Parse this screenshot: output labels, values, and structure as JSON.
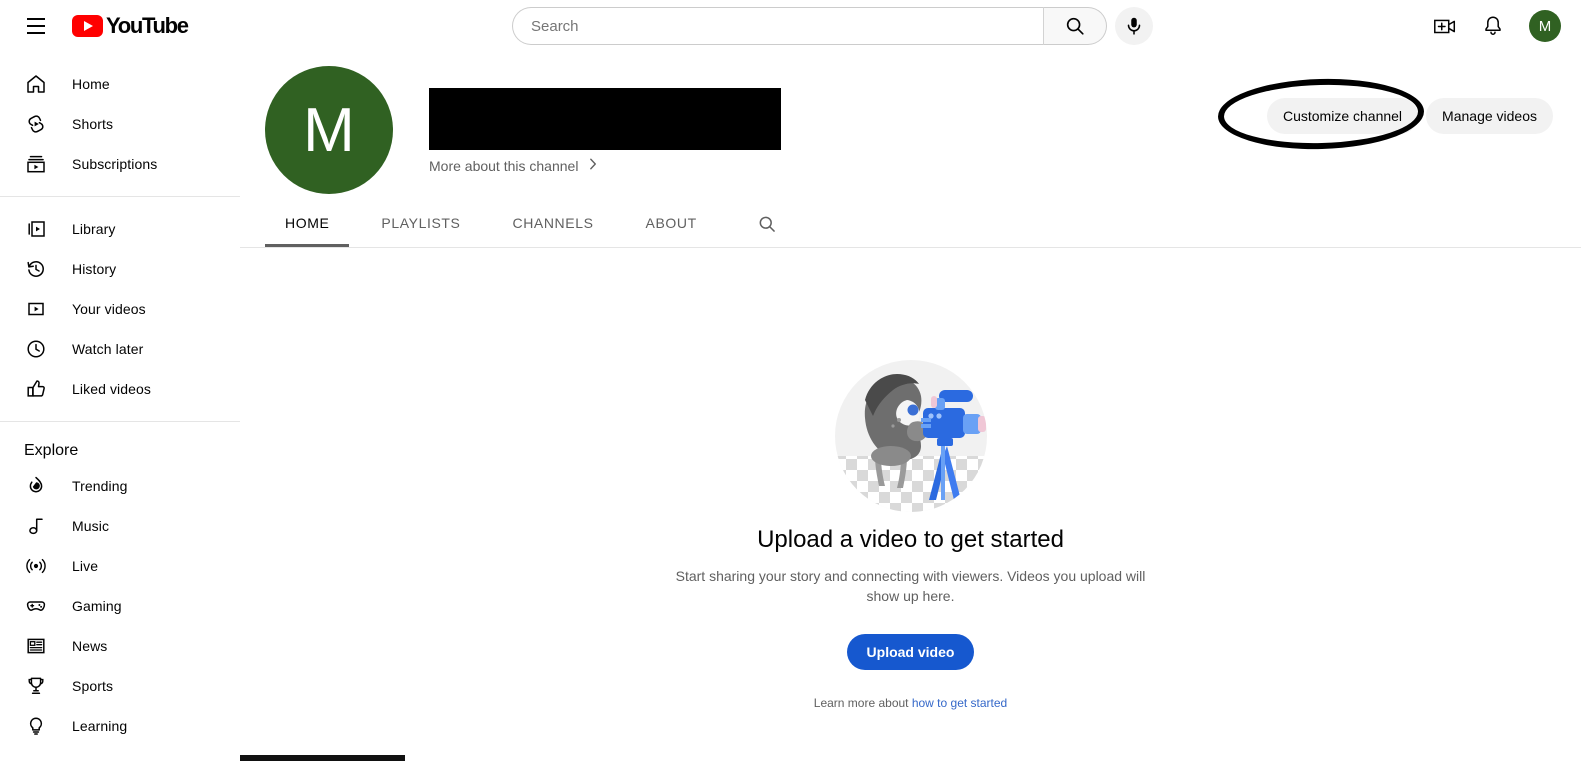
{
  "brand": {
    "name": "YouTube",
    "logo_color": "#FF0000",
    "accent_blue": "#1658cf",
    "avatar_color": "#306122"
  },
  "header": {
    "menu_icon": "hamburger-menu-icon",
    "logo_label": "YouTube",
    "search": {
      "placeholder": "Search",
      "value": "",
      "search_icon": "magnifier-icon",
      "mic_icon": "microphone-icon"
    },
    "create_icon": "create-video-icon",
    "notifications_icon": "bell-icon",
    "avatar_initial": "M"
  },
  "sidebar": {
    "primary": [
      {
        "label": "Home",
        "icon": "home-icon",
        "active": false
      },
      {
        "label": "Shorts",
        "icon": "shorts-icon",
        "active": false
      },
      {
        "label": "Subscriptions",
        "icon": "subscriptions-icon",
        "active": false
      }
    ],
    "library": [
      {
        "label": "Library",
        "icon": "library-icon"
      },
      {
        "label": "History",
        "icon": "history-icon"
      },
      {
        "label": "Your videos",
        "icon": "your-videos-icon"
      },
      {
        "label": "Watch later",
        "icon": "clock-icon"
      },
      {
        "label": "Liked videos",
        "icon": "thumbs-up-icon"
      }
    ],
    "explore_heading": "Explore",
    "explore": [
      {
        "label": "Trending",
        "icon": "trending-flame-icon"
      },
      {
        "label": "Music",
        "icon": "music-note-icon"
      },
      {
        "label": "Live",
        "icon": "live-broadcast-icon"
      },
      {
        "label": "Gaming",
        "icon": "gamepad-icon"
      },
      {
        "label": "News",
        "icon": "newspaper-icon"
      },
      {
        "label": "Sports",
        "icon": "trophy-icon"
      },
      {
        "label": "Learning",
        "icon": "lightbulb-icon"
      }
    ]
  },
  "channel": {
    "avatar_initial": "M",
    "name_redacted": true,
    "more_about_label": "More about this channel",
    "more_about_chevron": "chevron-right-icon",
    "customize_button": "Customize channel",
    "manage_button": "Manage videos",
    "annotation": {
      "type": "hand-drawn-ellipse",
      "target": "Customize channel",
      "color": "#000000"
    },
    "tabs": [
      {
        "label": "HOME",
        "active": true
      },
      {
        "label": "PLAYLISTS",
        "active": false
      },
      {
        "label": "CHANNELS",
        "active": false
      },
      {
        "label": "ABOUT",
        "active": false
      }
    ],
    "tab_search_icon": "magnifier-icon"
  },
  "empty_state": {
    "illustration": "person-with-video-camera-illustration",
    "title": "Upload a video to get started",
    "subtitle": "Start sharing your story and connecting with viewers. Videos you upload will show up here.",
    "upload_button": "Upload video",
    "learn_prefix": "Learn more about ",
    "learn_link": "how to get started"
  }
}
